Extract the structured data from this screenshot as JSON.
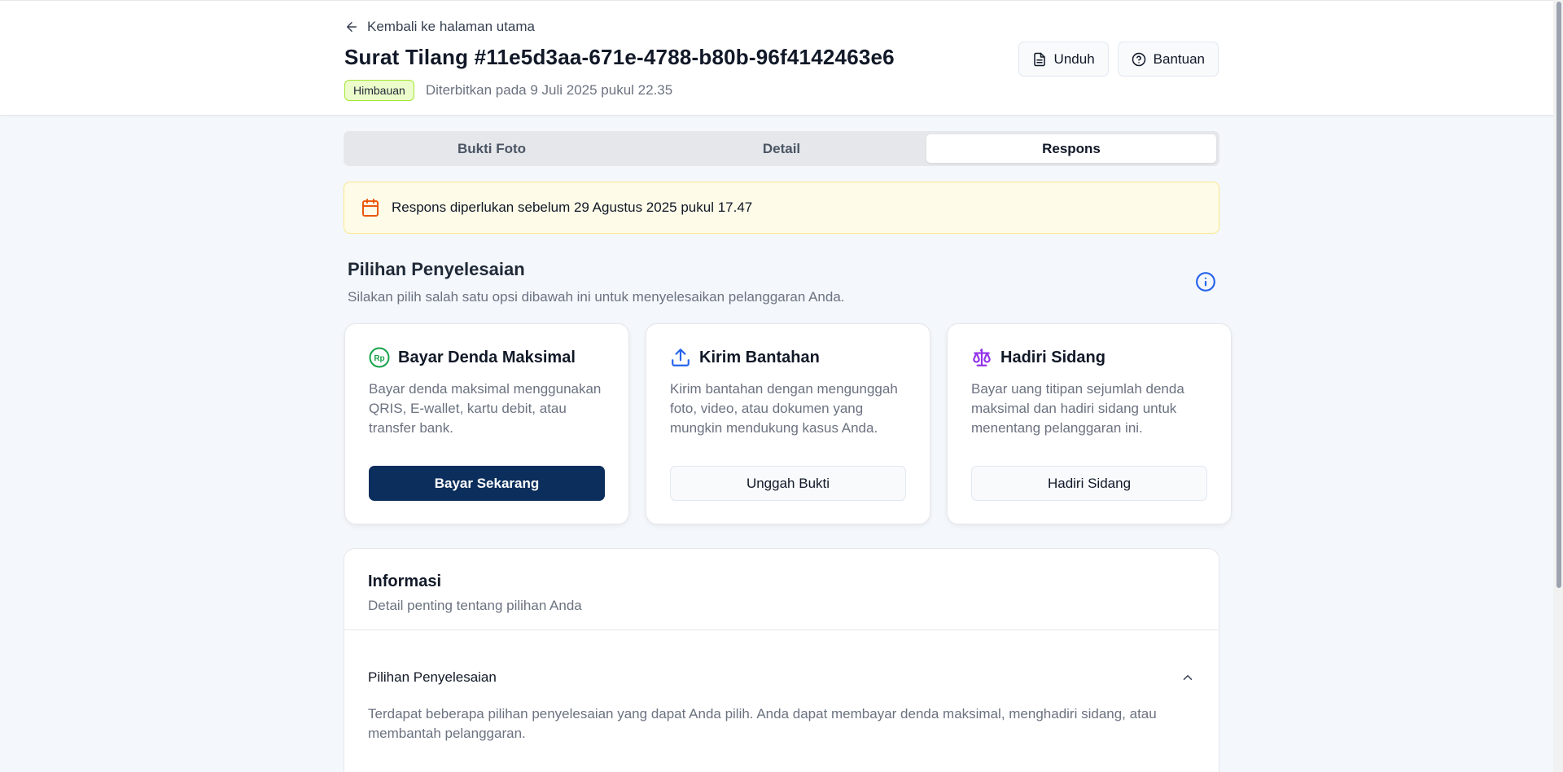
{
  "header": {
    "back_label": "Kembali ke halaman utama",
    "title": "Surat Tilang #11e5d3aa-671e-4788-b80b-96f4142463e6",
    "badge": "Himbauan",
    "issued": "Diterbitkan pada 9 Juli 2025 pukul 22.35",
    "actions": {
      "download": "Unduh",
      "help": "Bantuan"
    }
  },
  "tabs": [
    {
      "label": "Bukti Foto",
      "active": false
    },
    {
      "label": "Detail",
      "active": false
    },
    {
      "label": "Respons",
      "active": true
    }
  ],
  "deadline": {
    "text": "Respons diperlukan sebelum 29 Agustus 2025 pukul 17.47"
  },
  "options": {
    "title": "Pilihan Penyelesaian",
    "subtitle": "Silakan pilih salah satu opsi dibawah ini untuk menyelesaikan pelanggaran Anda.",
    "cards": [
      {
        "icon": "rupiah-icon",
        "icon_text": "Rp",
        "title": "Bayar Denda Maksimal",
        "desc": "Bayar denda maksimal menggunakan QRIS, E-wallet, kartu debit, atau transfer bank.",
        "button": "Bayar Sekarang",
        "color": "#16a34a"
      },
      {
        "icon": "upload-icon",
        "title": "Kirim Bantahan",
        "desc": "Kirim bantahan dengan mengunggah foto, video, atau dokumen yang mungkin mendukung kasus Anda.",
        "button": "Unggah Bukti",
        "color": "#2563eb"
      },
      {
        "icon": "scale-icon",
        "title": "Hadiri Sidang",
        "desc": "Bayar uang titipan sejumlah denda maksimal dan hadiri sidang untuk menentang pelanggaran ini.",
        "button": "Hadiri Sidang",
        "color": "#9333ea"
      }
    ]
  },
  "info": {
    "title": "Informasi",
    "subtitle": "Detail penting tentang pilihan Anda",
    "accordion": {
      "title": "Pilihan Penyelesaian",
      "body": "Terdapat beberapa pilihan penyelesaian yang dapat Anda pilih. Anda dapat membayar denda maksimal, menghadiri sidang, atau membantah pelanggaran."
    }
  },
  "colors": {
    "primary": "#0b2e5c",
    "badge_bg": "#ecfccb",
    "warning_bg": "#fefce8",
    "info": "#2563eb"
  }
}
